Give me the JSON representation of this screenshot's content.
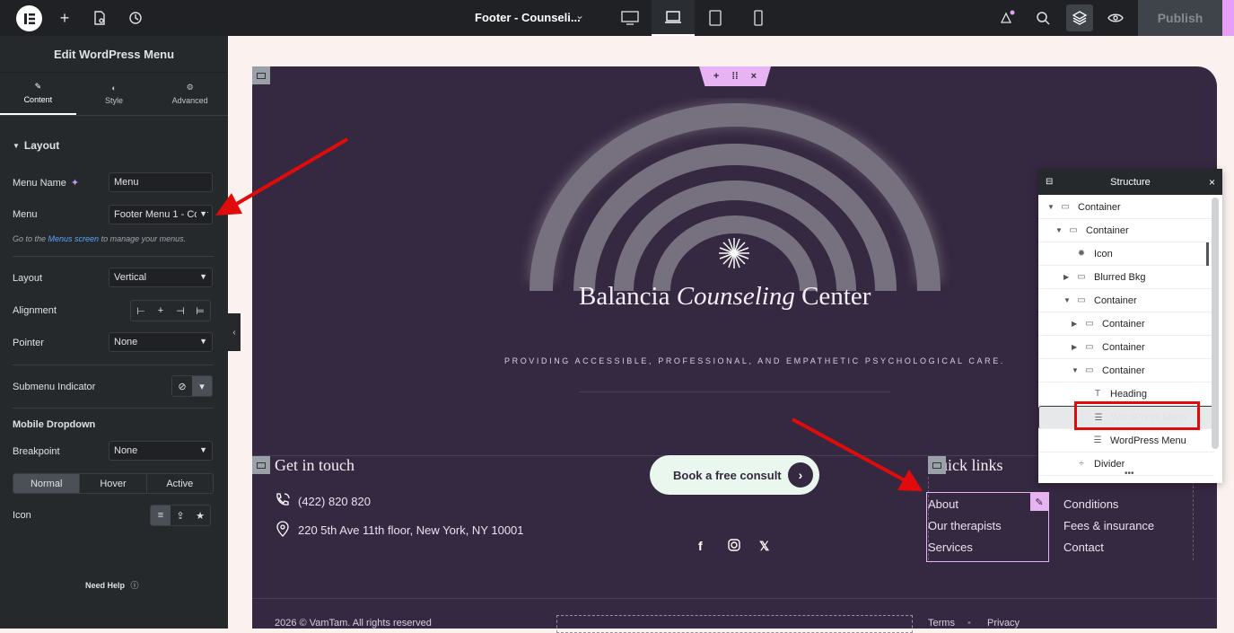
{
  "topbar": {
    "document_title": "Footer - Counseli...",
    "publish_label": "Publish",
    "icons": [
      "elementor-logo-icon",
      "plus-icon",
      "page-settings-icon",
      "history-icon",
      "chevron-down-icon",
      "desktop-icon",
      "laptop-icon",
      "tablet-icon",
      "mobile-icon",
      "notifications-icon",
      "search-icon",
      "layers-icon",
      "preview-eye-icon"
    ]
  },
  "panel": {
    "title": "Edit WordPress Menu",
    "tabs": [
      {
        "label": "Content",
        "icon": "pencil-icon"
      },
      {
        "label": "Style",
        "icon": "half-circle-icon"
      },
      {
        "label": "Advanced",
        "icon": "gear-icon"
      }
    ],
    "section_layout": "Layout",
    "menu_name_label": "Menu Name",
    "menu_name_value": "Menu",
    "menu_label": "Menu",
    "menu_value": "Footer Menu 1 - Cour",
    "note_prefix": "Go to the ",
    "note_link": "Menus screen",
    "note_suffix": " to manage your menus.",
    "layout_label": "Layout",
    "layout_value": "Vertical",
    "alignment_label": "Alignment",
    "pointer_label": "Pointer",
    "pointer_value": "None",
    "submenu_indicator_label": "Submenu Indicator",
    "mobile_dropdown_label": "Mobile Dropdown",
    "breakpoint_label": "Breakpoint",
    "breakpoint_value": "None",
    "states": [
      "Normal",
      "Hover",
      "Active"
    ],
    "icon_label": "Icon",
    "need_help": "Need Help"
  },
  "canvas": {
    "brand_before": "Balancia ",
    "brand_italic": "Counseling",
    "brand_after": " Center",
    "tagline": "PROVIDING ACCESSIBLE, PROFESSIONAL, AND EMPATHETIC PSYCHOLOGICAL CARE.",
    "get_in_touch": "Get in touch",
    "phone": "(422) 820 820",
    "address": "220 5th Ave 11th floor, New York, NY 10001",
    "cta": "Book a free consult",
    "quick_links": "Quick links",
    "menu1": [
      "About",
      "Our therapists",
      "Services"
    ],
    "menu2": [
      "Conditions",
      "Fees & insurance",
      "Contact"
    ],
    "copyright": "2026 © VamTam. All rights reserved",
    "footer_links": [
      "Terms",
      "Privacy"
    ]
  },
  "structure": {
    "title": "Structure",
    "rows": [
      {
        "label": "Container",
        "depth": 0,
        "twisty": "▼",
        "icon": "container-icon"
      },
      {
        "label": "Container",
        "depth": 1,
        "twisty": "▼",
        "icon": "container-icon"
      },
      {
        "label": "Icon",
        "depth": 2,
        "twisty": "",
        "icon": "icon-widget-icon"
      },
      {
        "label": "Blurred Bkg",
        "depth": 2,
        "twisty": "▶",
        "icon": "container-icon"
      },
      {
        "label": "Container",
        "depth": 2,
        "twisty": "▼",
        "icon": "container-icon"
      },
      {
        "label": "Container",
        "depth": 3,
        "twisty": "▶",
        "icon": "container-icon"
      },
      {
        "label": "Container",
        "depth": 3,
        "twisty": "▶",
        "icon": "container-icon"
      },
      {
        "label": "Container",
        "depth": 3,
        "twisty": "▼",
        "icon": "container-icon"
      },
      {
        "label": "Heading",
        "depth": 4,
        "twisty": "",
        "icon": "heading-icon"
      },
      {
        "label": "WordPress Menu",
        "depth": 4,
        "twisty": "",
        "icon": "menu-widget-icon",
        "selected": true
      },
      {
        "label": "WordPress Menu",
        "depth": 4,
        "twisty": "",
        "icon": "menu-widget-icon"
      },
      {
        "label": "Divider",
        "depth": 2,
        "twisty": "",
        "icon": "divider-icon"
      }
    ]
  },
  "colors": {
    "accent": "#e7b3f2",
    "canvas_bg": "#352841",
    "annotation": "#e10b0b"
  }
}
